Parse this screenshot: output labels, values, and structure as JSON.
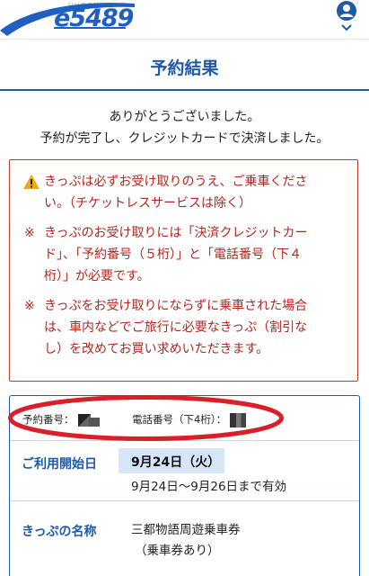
{
  "header": {
    "logo_text": "e5489",
    "logo_kana": "いいつこはやく"
  },
  "page": {
    "title": "予約結果"
  },
  "message": {
    "line1": "ありがとうございました。",
    "line2": "予約が完了し、クレジットカードで決済しました。"
  },
  "notice": {
    "warning_line1": "きっぷは必ずお受け取りのうえ、ご乗車くださ",
    "warning_line2": "い。（チケットレスサービスは除く）",
    "kome": "※",
    "note1_line1": "きっぷのお受け取りには「決済クレジットカー",
    "note1_line2": "ド」、「予約番号（５桁）」と「電話番号（下４",
    "note1_line3": "桁）」が必要です。",
    "note2_line1": "きっぷをお受け取りにならずに乗車された場合",
    "note2_line2": "は、車内などでご旅行に必要なきっぷ（割引な",
    "note2_line3": "し）を改めてお買い求めいただきます。"
  },
  "reservation": {
    "number_label": "予約番号：",
    "phone_label": "電話番号（下4桁）：",
    "start_label": "ご利用開始日",
    "start_date": "9月24日（火）",
    "valid_range": "9月24日～9月26日まで有効",
    "ticket_label": "きっぷの名称",
    "ticket_name": "三都物語周遊乗車券",
    "ticket_note": "（乗車券あり）"
  },
  "colors": {
    "brand_blue": "#1e5aa8",
    "warning_red": "#b3261e",
    "highlight_blue": "#d7e6f6"
  }
}
